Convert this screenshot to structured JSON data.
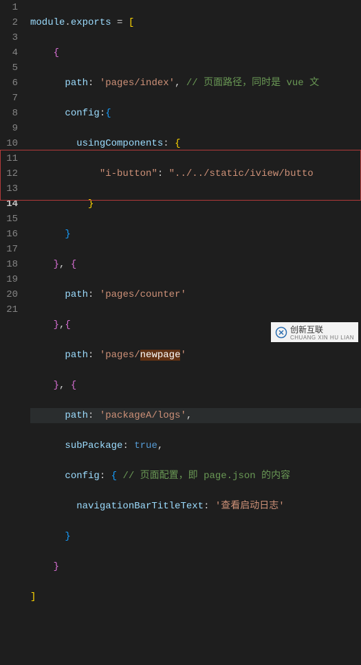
{
  "lines": [
    "1",
    "2",
    "3",
    "4",
    "5",
    "6",
    "7",
    "8",
    "9",
    "10",
    "11",
    "12",
    "13",
    "14",
    "15",
    "16",
    "17",
    "18",
    "19",
    "20",
    "21"
  ],
  "current_line_index": 13,
  "code": {
    "module": "module",
    "dot": ".",
    "exports": "exports",
    "eq": " = ",
    "ob": "[",
    "cb": "]",
    "oc": "{",
    "cc": "}",
    "path_key": "path",
    "config_key": "config",
    "usingComponents_key": "usingComponents",
    "ibutton_key": "\"i-button\"",
    "ibutton_val": "\"../../static/iview/butto",
    "path1": "'pages/index'",
    "comment1": "// 页面路径，同时是 vue 文",
    "path2": "'pages/counter'",
    "path3_pre": "'pages/",
    "path3_sel": "newpage",
    "path3_post": "'",
    "path4": "'packageA/logs'",
    "subPackage_key": "subPackage",
    "true_val": "true",
    "comment2": "// 页面配置，即 page.json 的内容",
    "navTitle_key": "navigationBarTitleText",
    "navTitle_val": "'查看启动日志'",
    "colon": ":",
    "comma": ","
  },
  "watermark": {
    "brand": "创新互联",
    "sub": "CHUANG XIN HU LIAN"
  }
}
